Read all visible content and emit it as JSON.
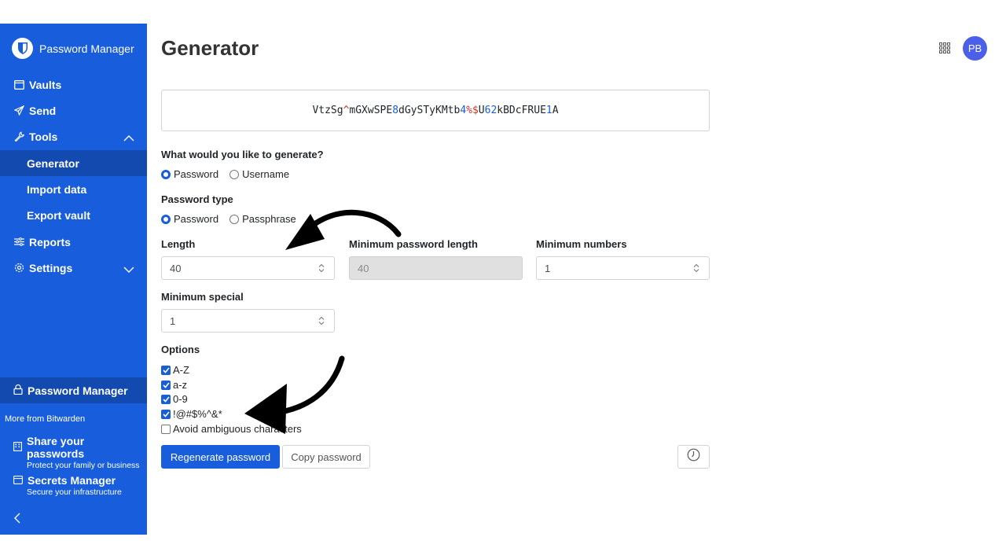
{
  "sidebar": {
    "brand": "Password Manager",
    "items": [
      {
        "label": "Vaults"
      },
      {
        "label": "Send"
      },
      {
        "label": "Tools"
      },
      {
        "label": "Generator"
      },
      {
        "label": "Import data"
      },
      {
        "label": "Export vault"
      },
      {
        "label": "Reports"
      },
      {
        "label": "Settings"
      }
    ],
    "product_switch": "Password Manager",
    "more_from": "More from Bitwarden",
    "promos": [
      {
        "title": "Share your passwords",
        "subtitle": "Protect your family or business"
      },
      {
        "title": "Secrets Manager",
        "subtitle": "Secure your infrastructure"
      }
    ]
  },
  "header": {
    "title": "Generator",
    "avatar_initials": "PB"
  },
  "generated": {
    "segments": [
      {
        "text": "VtzSg",
        "kind": "letter"
      },
      {
        "text": "^",
        "kind": "special"
      },
      {
        "text": "mGXwSPE",
        "kind": "letter"
      },
      {
        "text": "8",
        "kind": "number"
      },
      {
        "text": "dGySTyKMtb",
        "kind": "letter"
      },
      {
        "text": "4",
        "kind": "number"
      },
      {
        "text": "%$",
        "kind": "special"
      },
      {
        "text": "U",
        "kind": "letter"
      },
      {
        "text": "62",
        "kind": "number"
      },
      {
        "text": "kBDcFRUE",
        "kind": "letter"
      },
      {
        "text": "1",
        "kind": "number"
      },
      {
        "text": "A",
        "kind": "letter"
      }
    ]
  },
  "form": {
    "generate_question": "What would you like to generate?",
    "generate_options": [
      "Password",
      "Username"
    ],
    "password_type_label": "Password type",
    "password_type_options": [
      "Password",
      "Passphrase"
    ],
    "length_label": "Length",
    "length_value": "40",
    "min_length_label": "Minimum password length",
    "min_length_value": "40",
    "min_numbers_label": "Minimum numbers",
    "min_numbers_value": "1",
    "min_special_label": "Minimum special",
    "min_special_value": "1",
    "options_label": "Options",
    "options": [
      {
        "label": "A-Z",
        "checked": true
      },
      {
        "label": "a-z",
        "checked": true
      },
      {
        "label": "0-9",
        "checked": true
      },
      {
        "label": "!@#$%^&*",
        "checked": true
      },
      {
        "label": "Avoid ambiguous characters",
        "checked": false
      }
    ]
  },
  "actions": {
    "regenerate": "Regenerate password",
    "copy": "Copy password"
  },
  "colors": {
    "brand_blue": "#175ddc",
    "number_blue": "#175ddc",
    "special_red": "#c83522"
  }
}
